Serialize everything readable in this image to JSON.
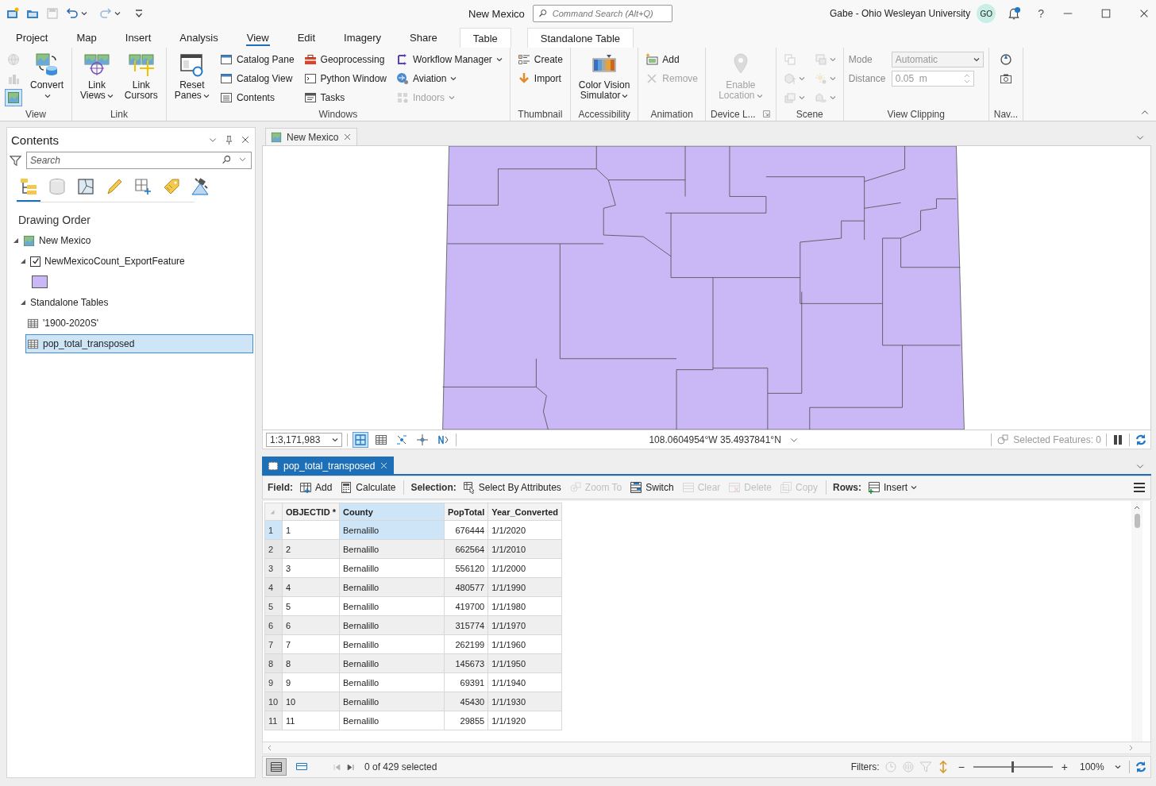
{
  "title_bar": {
    "title": "New Mexico",
    "command_search": {
      "placeholder": "Command Search (Alt+Q)"
    },
    "user": "Gabe - Ohio Wesleyan University",
    "avatar": "GO",
    "notification": true,
    "help": "?"
  },
  "quick_access": [
    {
      "disabled": false,
      "dropdown": false
    },
    {
      "disabled": false,
      "dropdown": false
    },
    {
      "disabled": true,
      "dropdown": false
    },
    {
      "disabled": false,
      "dropdown": true
    },
    {
      "disabled": true,
      "dropdown": true
    },
    {
      "disabled": false,
      "dropdown": false
    }
  ],
  "ribbon_tabs": [
    {
      "label": "Project",
      "kind": "normal",
      "selected": false
    },
    {
      "label": "Map",
      "kind": "normal",
      "selected": false
    },
    {
      "label": "Insert",
      "kind": "normal",
      "selected": false
    },
    {
      "label": "Analysis",
      "kind": "normal",
      "selected": false
    },
    {
      "label": "View",
      "kind": "normal",
      "selected": true
    },
    {
      "label": "Edit",
      "kind": "normal",
      "selected": false
    },
    {
      "label": "Imagery",
      "kind": "normal",
      "selected": false
    },
    {
      "label": "Share",
      "kind": "normal",
      "selected": false
    },
    {
      "label": "Table",
      "kind": "contextual",
      "selected": false
    },
    {
      "label": "Standalone Table",
      "kind": "contextual",
      "selected": false
    }
  ],
  "ribbon_groups": [
    {
      "label": "View",
      "controls": [
        {
          "kind": "icon",
          "disabled": true,
          "selected": false
        },
        {
          "kind": "icon",
          "disabled": true,
          "selected": false
        },
        {
          "kind": "icon",
          "disabled": false,
          "selected": true
        },
        {
          "kind": "large",
          "label": "Convert",
          "dropdown": true,
          "disabled": false
        }
      ]
    },
    {
      "label": "Link",
      "controls": [
        {
          "kind": "large",
          "label": "Link Views",
          "dropdown": true,
          "disabled": false
        },
        {
          "kind": "large",
          "label": "Link Cursors",
          "dropdown": false,
          "disabled": false
        }
      ]
    },
    {
      "label": "Windows",
      "controls": [
        {
          "kind": "large",
          "label": "Reset Panes",
          "dropdown": true,
          "disabled": false
        },
        {
          "kind": "small",
          "label": "Catalog Pane",
          "dropdown": false,
          "disabled": false
        },
        {
          "kind": "small",
          "label": "Catalog View",
          "dropdown": false,
          "disabled": false
        },
        {
          "kind": "small",
          "label": "Contents",
          "dropdown": false,
          "disabled": false
        },
        {
          "kind": "small",
          "label": "Geoprocessing",
          "dropdown": false,
          "disabled": false
        },
        {
          "kind": "small",
          "label": "Python Window",
          "dropdown": false,
          "disabled": false
        },
        {
          "kind": "small",
          "label": "Tasks",
          "dropdown": false,
          "disabled": false
        },
        {
          "kind": "small",
          "label": "Workflow Manager",
          "dropdown": true,
          "disabled": false
        },
        {
          "kind": "small",
          "label": "Aviation",
          "dropdown": true,
          "disabled": false
        },
        {
          "kind": "small",
          "label": "Indoors",
          "dropdown": true,
          "disabled": true
        }
      ]
    },
    {
      "label": "Thumbnail",
      "controls": [
        {
          "kind": "small",
          "label": "Create",
          "dropdown": false,
          "disabled": false
        },
        {
          "kind": "small",
          "label": "Import",
          "dropdown": false,
          "disabled": false
        }
      ]
    },
    {
      "label": "Accessibility",
      "controls": [
        {
          "kind": "large",
          "label": "Color Vision Simulator",
          "dropdown": true,
          "disabled": false
        }
      ]
    },
    {
      "label": "Animation",
      "controls": [
        {
          "kind": "small",
          "label": "Add",
          "dropdown": false,
          "disabled": false
        },
        {
          "kind": "small",
          "label": "Remove",
          "dropdown": false,
          "disabled": true
        }
      ]
    },
    {
      "label": "Device L...",
      "launcher": true,
      "controls": [
        {
          "kind": "large",
          "label": "Enable Location",
          "dropdown": true,
          "disabled": true
        }
      ]
    },
    {
      "label": "Scene",
      "controls": [
        {
          "kind": "icon",
          "disabled": true,
          "dropdown": false
        },
        {
          "kind": "icon",
          "disabled": true,
          "dropdown": true
        },
        {
          "kind": "icon",
          "disabled": true,
          "dropdown": true
        },
        {
          "kind": "icon",
          "disabled": true,
          "dropdown": true
        },
        {
          "kind": "icon",
          "disabled": true,
          "dropdown": true
        },
        {
          "kind": "icon",
          "disabled": true,
          "dropdown": true
        }
      ]
    },
    {
      "label": "View Clipping",
      "controls": [
        {
          "kind": "select-field",
          "label": "Mode",
          "value": "Automatic",
          "disabled": true
        },
        {
          "kind": "spin-field",
          "label": "Distance",
          "value": "0.05  m",
          "disabled": true
        }
      ]
    },
    {
      "label": "Nav...",
      "controls": [
        {
          "kind": "icon",
          "disabled": false
        },
        {
          "kind": "icon",
          "disabled": false
        }
      ]
    }
  ],
  "contents": {
    "title": "Contents",
    "search": {
      "placeholder": "Search"
    },
    "view_tabs": [
      {
        "selected": true
      },
      {
        "selected": false
      },
      {
        "selected": false
      },
      {
        "selected": false
      },
      {
        "selected": false
      },
      {
        "selected": false
      },
      {
        "selected": false
      }
    ],
    "heading": "Drawing Order",
    "tree": [
      {
        "kind": "map",
        "label": "New Mexico",
        "expanded": true,
        "selected": false,
        "children": [
          {
            "kind": "layer",
            "label": "NewMexicoCount_ExportFeature",
            "checked": true,
            "expanded": true,
            "selected": false,
            "children": [
              {
                "kind": "symbol",
                "color": "#c9b8f5"
              }
            ]
          },
          {
            "kind": "group",
            "label": "Standalone Tables",
            "expanded": true,
            "selected": false,
            "children": [
              {
                "kind": "table",
                "label": "'1900-2020S'",
                "selected": false
              },
              {
                "kind": "table",
                "label": "pop_total_transposed",
                "selected": true
              }
            ]
          }
        ]
      }
    ]
  },
  "map_view": {
    "tab": {
      "label": "New Mexico",
      "selected": false
    },
    "scale": "1:3,171,983",
    "tools": [
      {
        "selected": true
      },
      {
        "selected": false
      },
      {
        "selected": false
      },
      {
        "selected": false
      },
      {
        "selected": false
      }
    ],
    "coordinates": "108.0604954°W 35.4937841°N",
    "selected_features": "Selected Features: 0"
  },
  "table_view": {
    "tab": {
      "label": "pop_total_transposed",
      "selected": true
    },
    "toolbar": [
      {
        "kind": "heading",
        "label": "Field:"
      },
      {
        "kind": "button",
        "label": "Add",
        "disabled": false
      },
      {
        "kind": "button",
        "label": "Calculate",
        "disabled": false
      },
      {
        "kind": "separator"
      },
      {
        "kind": "heading",
        "label": "Selection:"
      },
      {
        "kind": "button",
        "label": "Select By Attributes",
        "disabled": false
      },
      {
        "kind": "button",
        "label": "Zoom To",
        "disabled": true
      },
      {
        "kind": "button",
        "label": "Switch",
        "disabled": false
      },
      {
        "kind": "button",
        "label": "Clear",
        "disabled": true
      },
      {
        "kind": "button",
        "label": "Delete",
        "disabled": true
      },
      {
        "kind": "button",
        "label": "Copy",
        "disabled": true
      },
      {
        "kind": "separator"
      },
      {
        "kind": "heading",
        "label": "Rows:"
      },
      {
        "kind": "button",
        "label": "Insert",
        "disabled": false,
        "dropdown": true
      }
    ],
    "columns": [
      {
        "label": "OBJECTID *",
        "kind": "text",
        "current": false
      },
      {
        "label": "County",
        "kind": "text",
        "current": true
      },
      {
        "label": "PopTotal",
        "kind": "number",
        "current": false
      },
      {
        "label": "Year_Converted",
        "kind": "text",
        "current": false
      }
    ],
    "rows": [
      {
        "number": "1",
        "current": true,
        "cells": [
          "1",
          "Bernalillo",
          "676444",
          "1/1/2020"
        ]
      },
      {
        "number": "2",
        "current": false,
        "cells": [
          "2",
          "Bernalillo",
          "662564",
          "1/1/2010"
        ]
      },
      {
        "number": "3",
        "current": false,
        "cells": [
          "3",
          "Bernalillo",
          "556120",
          "1/1/2000"
        ]
      },
      {
        "number": "4",
        "current": false,
        "cells": [
          "4",
          "Bernalillo",
          "480577",
          "1/1/1990"
        ]
      },
      {
        "number": "5",
        "current": false,
        "cells": [
          "5",
          "Bernalillo",
          "419700",
          "1/1/1980"
        ]
      },
      {
        "number": "6",
        "current": false,
        "cells": [
          "6",
          "Bernalillo",
          "315774",
          "1/1/1970"
        ]
      },
      {
        "number": "7",
        "current": false,
        "cells": [
          "7",
          "Bernalillo",
          "262199",
          "1/1/1960"
        ]
      },
      {
        "number": "8",
        "current": false,
        "cells": [
          "8",
          "Bernalillo",
          "145673",
          "1/1/1950"
        ]
      },
      {
        "number": "9",
        "current": false,
        "cells": [
          "9",
          "Bernalillo",
          "69391",
          "1/1/1940"
        ]
      },
      {
        "number": "10",
        "current": false,
        "cells": [
          "10",
          "Bernalillo",
          "45430",
          "1/1/1930"
        ]
      },
      {
        "number": "11",
        "current": false,
        "cells": [
          "11",
          "Bernalillo",
          "29855",
          "1/1/1920"
        ]
      }
    ],
    "footer": {
      "view_modes": [
        {
          "selected": true
        },
        {
          "selected": false
        }
      ],
      "nav": [
        {
          "disabled": true
        },
        {
          "disabled": false
        }
      ],
      "selection": "0 of 429 selected",
      "filters_label": "Filters:",
      "filters": [
        {
          "disabled": true
        },
        {
          "disabled": true
        },
        {
          "disabled": true
        },
        {
          "disabled": false
        }
      ],
      "zoom_out": "−",
      "zoom": {
        "level": 0.49,
        "reading": "100%"
      },
      "zoom_in": "+"
    }
  }
}
